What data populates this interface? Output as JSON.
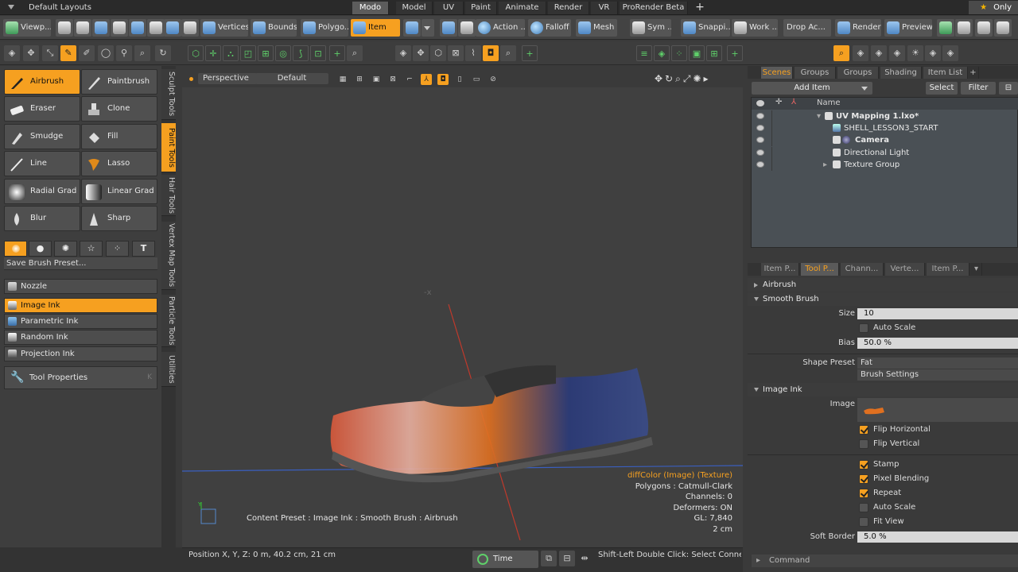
{
  "topbar": {
    "layouts": "Default Layouts",
    "tabs": [
      "Modo",
      "Model",
      "UV",
      "Paint",
      "Animate",
      "Render",
      "VR",
      "ProRender Beta"
    ],
    "plus": "+",
    "only": "Only",
    "star": "★"
  },
  "toolbar": {
    "viewport": "Viewp...",
    "vertices": "Vertices",
    "bounds": "Bounds",
    "polygons": "Polygo...",
    "item": "Item",
    "action": "Action ...",
    "falloff": "Falloff",
    "mesh": "Mesh",
    "sym": "Sym ...",
    "snapping": "Snappi...",
    "work": "Work ...",
    "drop_action": "Drop Ac...",
    "render": "Render",
    "preview": "Preview"
  },
  "paint_tools": [
    {
      "label": "Airbrush",
      "icon": "airbrush-icon",
      "selected": true
    },
    {
      "label": "Paintbrush",
      "icon": "paintbrush-icon"
    },
    {
      "label": "Eraser",
      "icon": "eraser-icon"
    },
    {
      "label": "Clone",
      "icon": "clone-icon"
    },
    {
      "label": "Smudge",
      "icon": "smudge-icon"
    },
    {
      "label": "Fill",
      "icon": "fill-icon"
    },
    {
      "label": "Line",
      "icon": "line-icon"
    },
    {
      "label": "Lasso",
      "icon": "lasso-icon"
    },
    {
      "label": "Radial Grad ...",
      "icon": "radial-gradient-icon"
    },
    {
      "label": "Linear Grad ...",
      "icon": "linear-gradient-icon"
    },
    {
      "label": "Blur",
      "icon": "blur-icon"
    },
    {
      "label": "Sharp",
      "icon": "sharp-icon"
    }
  ],
  "brush_tabs": [
    "●",
    "●",
    "✺",
    "☆",
    "⁘",
    "T"
  ],
  "save_brush": "Save Brush Preset...",
  "inks": [
    {
      "label": "Nozzle",
      "selected": false
    },
    {
      "label": "Image Ink",
      "selected": true
    },
    {
      "label": "Parametric Ink",
      "selected": false
    },
    {
      "label": "Random Ink",
      "selected": false
    },
    {
      "label": "Projection Ink",
      "selected": false
    }
  ],
  "tool_properties": "Tool Properties",
  "tool_properties_key": "K",
  "vertical_tabs": [
    "Sculpt Tools",
    "Paint Tools",
    "Hair Tools",
    "Vertex Map Tools",
    "Particle Tools",
    "Utilities"
  ],
  "viewport": {
    "view": "Perspective",
    "style": "Default",
    "info": {
      "line1": "diffColor (Image) (Texture)",
      "line2": "Polygons : Catmull-Clark",
      "line3": "Channels: 0",
      "line4": "Deformers: ON",
      "line5": "GL: 7,840",
      "line6": "2 cm"
    },
    "content_preset": "Content Preset : Image Ink : Smooth Brush : Airbrush"
  },
  "statusbar": {
    "position": "Position X, Y, Z:   0 m, 40.2 cm, 21 cm",
    "time": "Time",
    "hint": "Shift-Left Double Click: Select Connec..."
  },
  "scenes": {
    "tabs": [
      "Scenes",
      "Groups",
      "Groups",
      "Shading",
      "Item List",
      "+"
    ],
    "add_item": "Add Item",
    "select": "Select",
    "filter": "Filter",
    "name_header": "Name",
    "rows": [
      "UV Mapping 1.lxo*",
      "SHELL_LESSON3_START",
      "Camera",
      "Directional Light",
      "Texture Group"
    ]
  },
  "properties": {
    "tabs": [
      "Item P...",
      "Tool P...",
      "Chann...",
      "Verte...",
      "Item P..."
    ],
    "airbrush": "Airbrush",
    "smooth_brush": "Smooth Brush",
    "size_label": "Size",
    "size_value": "10",
    "auto_scale": "Auto Scale",
    "bias_label": "Bias",
    "bias_value": "50.0 %",
    "shape_preset_label": "Shape Preset",
    "shape_preset_value": "Fat",
    "brush_settings": "Brush Settings",
    "image_ink": "Image Ink",
    "image_label": "Image",
    "flip_horizontal": "Flip Horizontal",
    "flip_vertical": "Flip Vertical",
    "stamp": "Stamp",
    "pixel_blending": "Pixel Blending",
    "repeat": "Repeat",
    "auto_scale2": "Auto Scale",
    "fit_view": "Fit View",
    "soft_border_label": "Soft Border",
    "soft_border_value": "5.0 %",
    "command": "Command"
  }
}
